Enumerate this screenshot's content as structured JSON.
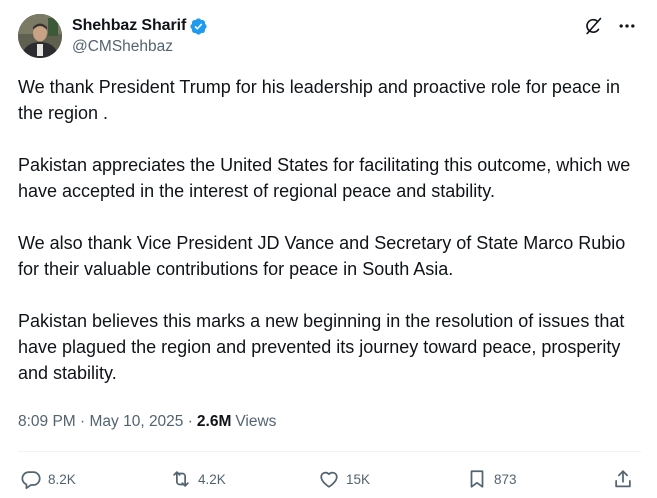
{
  "author": {
    "display_name": "Shehbaz Sharif",
    "handle": "@CMShehbaz",
    "verified": true
  },
  "tweet": {
    "paragraphs": [
      "We thank President Trump for his leadership and proactive role for peace in the region .",
      "Pakistan appreciates the United States for facilitating this outcome, which we have accepted in the interest of regional peace and stability.",
      "We also thank Vice President JD Vance and Secretary of State Marco Rubio for their valuable contributions for peace in South Asia.",
      "Pakistan believes this marks a new beginning in the resolution of issues that have plagued the region and prevented its journey toward peace, prosperity and stability."
    ],
    "timestamp": "8:09 PM · May 10, 2025 ·",
    "views_count": "2.6M",
    "views_label": "Views"
  },
  "actions": {
    "replies": "8.2K",
    "reposts": "4.2K",
    "likes": "15K",
    "bookmarks": "873"
  },
  "icons": {
    "grok": "grok-icon",
    "more": "more-icon",
    "verified": "verified-badge-icon",
    "reply": "reply-icon",
    "repost": "repost-icon",
    "like": "like-icon",
    "bookmark": "bookmark-icon",
    "share": "share-icon"
  },
  "colors": {
    "text_primary": "#0f1419",
    "text_secondary": "#536471",
    "verified": "#1d9bf0",
    "divider": "#eff3f4"
  }
}
